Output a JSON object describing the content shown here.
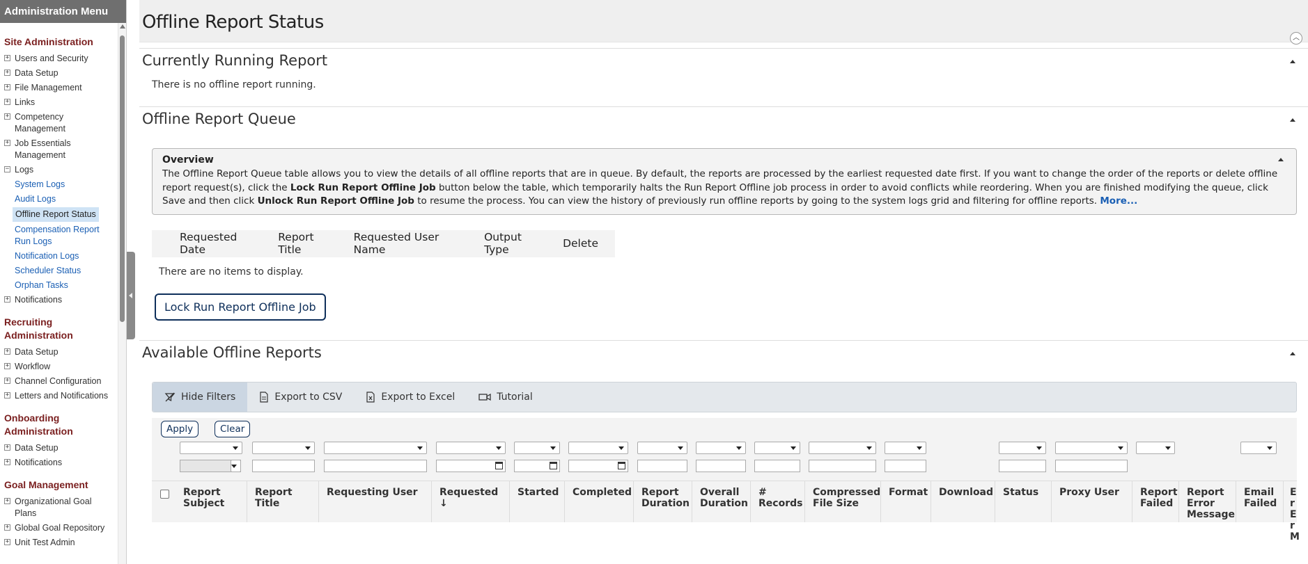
{
  "sidebar": {
    "title": "Administration Menu",
    "site_admin": {
      "heading": "Site Administration",
      "items": [
        "Users and Security",
        "Data Setup",
        "File Management",
        "Links",
        "Competency Management",
        "Job Essentials Management"
      ],
      "logs_label": "Logs",
      "logs_children": [
        "System Logs",
        "Audit Logs",
        "Offline Report Status",
        "Compensation Report Run Logs",
        "Notification Logs",
        "Scheduler Status",
        "Orphan Tasks"
      ],
      "notifications": "Notifications"
    },
    "recruiting": {
      "heading": "Recruiting Administration",
      "items": [
        "Data Setup",
        "Workflow",
        "Channel Configuration",
        "Letters and Notifications"
      ]
    },
    "onboarding": {
      "heading": "Onboarding Administration",
      "items": [
        "Data Setup",
        "Notifications"
      ]
    },
    "goal": {
      "heading": "Goal Management",
      "items": [
        "Organizational Goal Plans",
        "Global Goal Repository",
        "Unit Test Admin"
      ]
    }
  },
  "page": {
    "title": "Offline Report Status"
  },
  "running": {
    "title": "Currently Running Report",
    "message": "There is no offline report running."
  },
  "queue": {
    "title": "Offline Report Queue",
    "overview_title": "Overview",
    "overview_p1": "The Offline Report Queue table allows you to view the details of all offline reports that are in queue. By default, the reports are processed by the earliest requested date first. If you want to change the order of the reports or delete offline report request(s), click the ",
    "overview_b1": "Lock Run Report Offline Job",
    "overview_p2": " button below the table, which temporarily halts the Run Report Offline job process in order to avoid conflicts while reordering. When you are finished modifying the queue, click Save and then click ",
    "overview_b2": "Unlock Run Report Offline Job",
    "overview_p3": " to resume the process. You can view the history of previously run offline reports by going to the system logs grid and filtering for offline reports. ",
    "overview_more": "More...",
    "columns": [
      "Requested Date",
      "Report Title",
      "Requested User Name",
      "Output Type",
      "Delete"
    ],
    "empty": "There are no items to display.",
    "lock_button": "Lock Run Report Offline Job"
  },
  "available": {
    "title": "Available Offline Reports",
    "toolbar": {
      "hide_filters": "Hide Filters",
      "export_csv": "Export to CSV",
      "export_excel": "Export to Excel",
      "tutorial": "Tutorial"
    },
    "apply": "Apply",
    "clear": "Clear",
    "headers": [
      "Report Subject",
      "Report Title",
      "Requesting User",
      "Requested ↓",
      "Started",
      "Completed",
      "Report Duration",
      "Overall Duration",
      "# Records",
      "Compressed File Size",
      "Format",
      "Download",
      "Status",
      "Proxy User",
      "Report Failed",
      "Report Error Message",
      "Email Failed",
      "Er Er M"
    ]
  },
  "colors": {
    "accent": "#1a5fb4",
    "heading_red": "#7a1f1f",
    "button_navy": "#0e2f5a"
  }
}
